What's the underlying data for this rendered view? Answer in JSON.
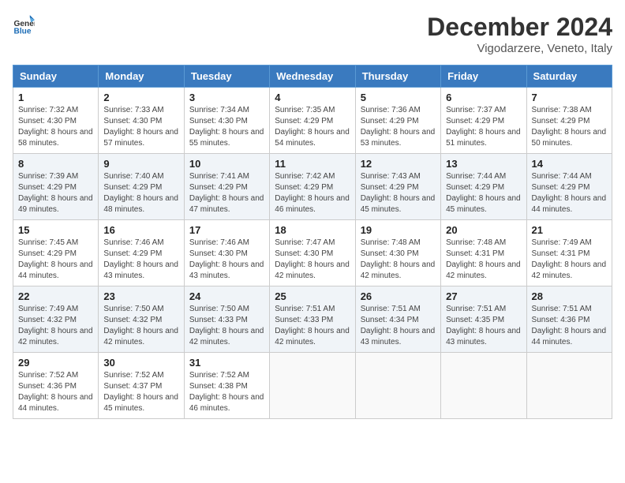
{
  "header": {
    "logo_line1": "General",
    "logo_line2": "Blue",
    "title": "December 2024",
    "subtitle": "Vigodarzere, Veneto, Italy"
  },
  "days_of_week": [
    "Sunday",
    "Monday",
    "Tuesday",
    "Wednesday",
    "Thursday",
    "Friday",
    "Saturday"
  ],
  "weeks": [
    [
      {
        "day": "1",
        "sunrise": "7:32 AM",
        "sunset": "4:30 PM",
        "daylight": "8 hours and 58 minutes."
      },
      {
        "day": "2",
        "sunrise": "7:33 AM",
        "sunset": "4:30 PM",
        "daylight": "8 hours and 57 minutes."
      },
      {
        "day": "3",
        "sunrise": "7:34 AM",
        "sunset": "4:30 PM",
        "daylight": "8 hours and 55 minutes."
      },
      {
        "day": "4",
        "sunrise": "7:35 AM",
        "sunset": "4:29 PM",
        "daylight": "8 hours and 54 minutes."
      },
      {
        "day": "5",
        "sunrise": "7:36 AM",
        "sunset": "4:29 PM",
        "daylight": "8 hours and 53 minutes."
      },
      {
        "day": "6",
        "sunrise": "7:37 AM",
        "sunset": "4:29 PM",
        "daylight": "8 hours and 51 minutes."
      },
      {
        "day": "7",
        "sunrise": "7:38 AM",
        "sunset": "4:29 PM",
        "daylight": "8 hours and 50 minutes."
      }
    ],
    [
      {
        "day": "8",
        "sunrise": "7:39 AM",
        "sunset": "4:29 PM",
        "daylight": "8 hours and 49 minutes."
      },
      {
        "day": "9",
        "sunrise": "7:40 AM",
        "sunset": "4:29 PM",
        "daylight": "8 hours and 48 minutes."
      },
      {
        "day": "10",
        "sunrise": "7:41 AM",
        "sunset": "4:29 PM",
        "daylight": "8 hours and 47 minutes."
      },
      {
        "day": "11",
        "sunrise": "7:42 AM",
        "sunset": "4:29 PM",
        "daylight": "8 hours and 46 minutes."
      },
      {
        "day": "12",
        "sunrise": "7:43 AM",
        "sunset": "4:29 PM",
        "daylight": "8 hours and 45 minutes."
      },
      {
        "day": "13",
        "sunrise": "7:44 AM",
        "sunset": "4:29 PM",
        "daylight": "8 hours and 45 minutes."
      },
      {
        "day": "14",
        "sunrise": "7:44 AM",
        "sunset": "4:29 PM",
        "daylight": "8 hours and 44 minutes."
      }
    ],
    [
      {
        "day": "15",
        "sunrise": "7:45 AM",
        "sunset": "4:29 PM",
        "daylight": "8 hours and 44 minutes."
      },
      {
        "day": "16",
        "sunrise": "7:46 AM",
        "sunset": "4:29 PM",
        "daylight": "8 hours and 43 minutes."
      },
      {
        "day": "17",
        "sunrise": "7:46 AM",
        "sunset": "4:30 PM",
        "daylight": "8 hours and 43 minutes."
      },
      {
        "day": "18",
        "sunrise": "7:47 AM",
        "sunset": "4:30 PM",
        "daylight": "8 hours and 42 minutes."
      },
      {
        "day": "19",
        "sunrise": "7:48 AM",
        "sunset": "4:30 PM",
        "daylight": "8 hours and 42 minutes."
      },
      {
        "day": "20",
        "sunrise": "7:48 AM",
        "sunset": "4:31 PM",
        "daylight": "8 hours and 42 minutes."
      },
      {
        "day": "21",
        "sunrise": "7:49 AM",
        "sunset": "4:31 PM",
        "daylight": "8 hours and 42 minutes."
      }
    ],
    [
      {
        "day": "22",
        "sunrise": "7:49 AM",
        "sunset": "4:32 PM",
        "daylight": "8 hours and 42 minutes."
      },
      {
        "day": "23",
        "sunrise": "7:50 AM",
        "sunset": "4:32 PM",
        "daylight": "8 hours and 42 minutes."
      },
      {
        "day": "24",
        "sunrise": "7:50 AM",
        "sunset": "4:33 PM",
        "daylight": "8 hours and 42 minutes."
      },
      {
        "day": "25",
        "sunrise": "7:51 AM",
        "sunset": "4:33 PM",
        "daylight": "8 hours and 42 minutes."
      },
      {
        "day": "26",
        "sunrise": "7:51 AM",
        "sunset": "4:34 PM",
        "daylight": "8 hours and 43 minutes."
      },
      {
        "day": "27",
        "sunrise": "7:51 AM",
        "sunset": "4:35 PM",
        "daylight": "8 hours and 43 minutes."
      },
      {
        "day": "28",
        "sunrise": "7:51 AM",
        "sunset": "4:36 PM",
        "daylight": "8 hours and 44 minutes."
      }
    ],
    [
      {
        "day": "29",
        "sunrise": "7:52 AM",
        "sunset": "4:36 PM",
        "daylight": "8 hours and 44 minutes."
      },
      {
        "day": "30",
        "sunrise": "7:52 AM",
        "sunset": "4:37 PM",
        "daylight": "8 hours and 45 minutes."
      },
      {
        "day": "31",
        "sunrise": "7:52 AM",
        "sunset": "4:38 PM",
        "daylight": "8 hours and 46 minutes."
      },
      null,
      null,
      null,
      null
    ]
  ],
  "labels": {
    "sunrise": "Sunrise:",
    "sunset": "Sunset:",
    "daylight": "Daylight:"
  }
}
